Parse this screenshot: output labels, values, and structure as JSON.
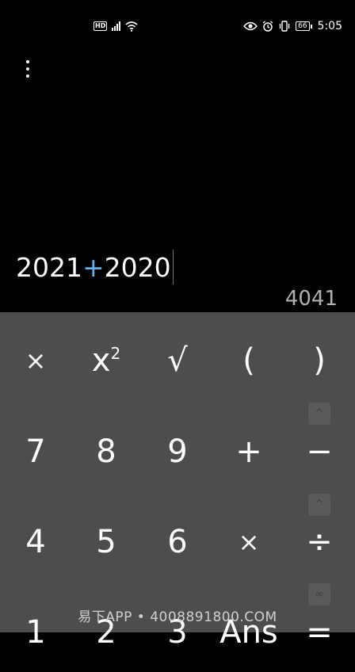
{
  "status_bar": {
    "network_badge": "HD",
    "signal_label": "4G",
    "battery": "66",
    "time": "5:05",
    "icons": [
      "hd-icon",
      "signal-icon",
      "wifi-icon",
      "eye-icon",
      "alarm-icon",
      "vibrate-icon",
      "battery-icon"
    ]
  },
  "display": {
    "expr_a": "2021",
    "expr_op": "+",
    "expr_b": "2020",
    "result": "4041"
  },
  "keys": {
    "row1": [
      "×",
      "x²",
      "√",
      "(",
      ")"
    ],
    "row2": [
      "7",
      "8",
      "9",
      "+",
      "−"
    ],
    "row3": [
      "4",
      "5",
      "6",
      "×",
      "÷"
    ],
    "row4": [
      "1",
      "2",
      "3",
      "Ans",
      "="
    ]
  },
  "mini_toggles": [
    "^",
    "^",
    "∞"
  ],
  "watermark": "易下APP • 4008891800.COM",
  "colors": {
    "background": "#000000",
    "keypad": "#4d4d4d",
    "operator_accent": "#5fb3e8",
    "result_text": "#b0b0b0"
  }
}
